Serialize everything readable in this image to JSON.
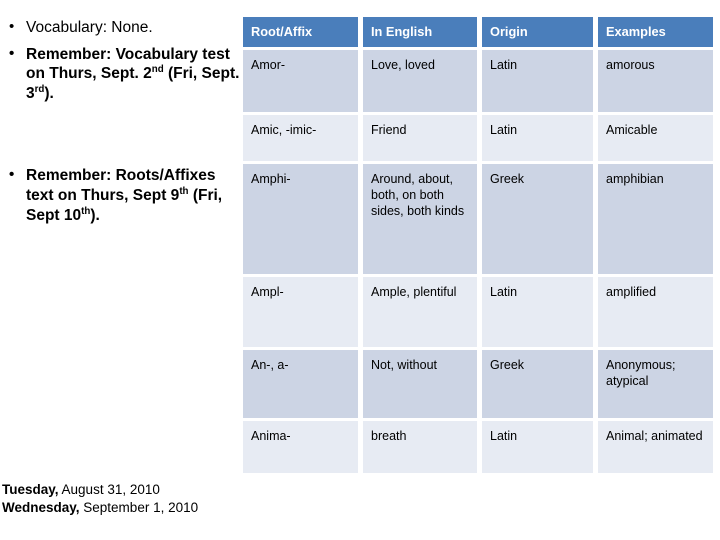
{
  "slide": {
    "background_color": "#ffffff",
    "header_accent_color": "#4a7ebb",
    "row_band_dark_color": "#ccd4e4",
    "row_band_light_color": "#e7ebf3"
  },
  "left_pane": {
    "bullets": [
      {
        "id": "vocabulary",
        "bold": false,
        "segments": [
          {
            "text": "Vocabulary: None."
          }
        ]
      },
      {
        "id": "vocab-test-reminder",
        "bold": true,
        "segments": [
          {
            "text": "Remember: Vocabulary test on Thurs, Sept. 2"
          },
          {
            "text": "nd",
            "sup": true
          },
          {
            "text": " (Fri, Sept. 3"
          },
          {
            "text": "rd",
            "sup": true
          },
          {
            "text": ")."
          }
        ]
      },
      {
        "id": "roots-affixes-reminder",
        "bold": true,
        "segments": [
          {
            "text": "Remember: Roots/Affixes text on Thurs, Sept 9"
          },
          {
            "text": "th",
            "sup": true
          },
          {
            "text": " (Fri, Sept 10"
          },
          {
            "text": "th",
            "sup": true
          },
          {
            "text": ")."
          }
        ]
      }
    ],
    "bullet_plain_text": {
      "vocabulary": "Vocabulary: None.",
      "vocab_test_reminder": "Remember: Vocabulary test on Thurs, Sept. 2nd (Fri, Sept. 3rd).",
      "roots_affixes_reminder": "Remember: Roots/Affixes text on Thurs, Sept 9th (Fri, Sept 10th)."
    },
    "dates": [
      {
        "dayname": "Tuesday,",
        "datepart": " August 31, 2010"
      },
      {
        "dayname": "Wednesday,",
        "datepart": " September 1, 2010"
      }
    ]
  },
  "table": {
    "columns": [
      "Root/Affix",
      "In English",
      "Origin",
      "Examples"
    ],
    "rows": [
      {
        "root": "Amor-",
        "english": "Love, loved",
        "origin": "Latin",
        "examples": "amorous"
      },
      {
        "root": "Amic, -imic-",
        "english": "Friend",
        "origin": "Latin",
        "examples": "Amicable"
      },
      {
        "root": "Amphi-",
        "english": "Around, about, both, on both sides, both kinds",
        "origin": "Greek",
        "examples": "amphibian"
      },
      {
        "root": "Ampl-",
        "english": "Ample, plentiful",
        "origin": "Latin",
        "examples": "amplified"
      },
      {
        "root": "An-, a-",
        "english": "Not, without",
        "origin": "Greek",
        "examples": "Anonymous; atypical"
      },
      {
        "root": "Anima-",
        "english": "breath",
        "origin": "Latin",
        "examples": "Animal; animated"
      }
    ]
  }
}
